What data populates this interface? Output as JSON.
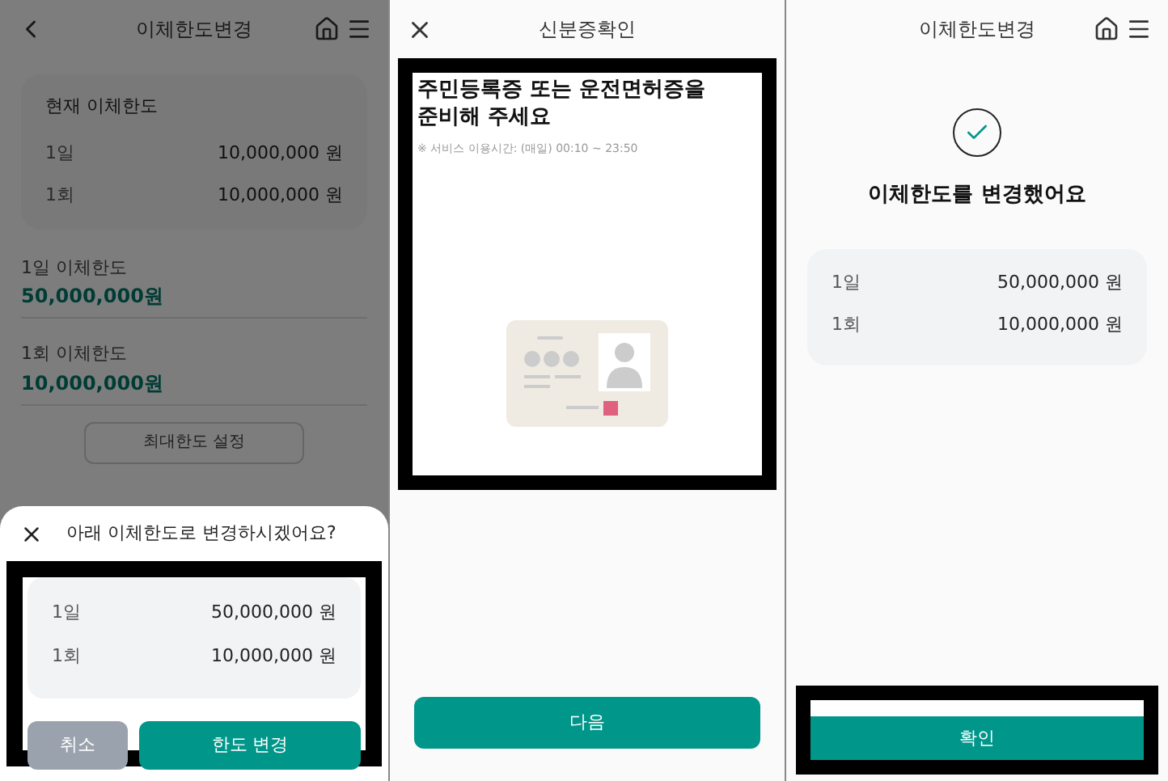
{
  "screen_1": {
    "header": {
      "title": "이체한도변경"
    },
    "current_limit": {
      "title": "현재 이체한도",
      "rows": [
        {
          "label": "1일",
          "value": "10,000,000 원"
        },
        {
          "label": "1회",
          "value": "10,000,000 원"
        }
      ]
    },
    "fields": [
      {
        "label": "1일 이체한도",
        "value": "50,000,000원"
      },
      {
        "label": "1회 이체한도",
        "value": "10,000,000원"
      }
    ],
    "max_button": "최대한도 설정",
    "sheet": {
      "title": "아래 이체한도로 변경하시겠어요?",
      "rows": [
        {
          "label": "1일",
          "value": "50,000,000 원"
        },
        {
          "label": "1회",
          "value": "10,000,000 원"
        }
      ],
      "cancel": "취소",
      "confirm": "한도 변경"
    }
  },
  "screen_2": {
    "header": {
      "title": "신분증확인"
    },
    "heading": "주민등록증 또는 운전면허증을\n준비해 주세요",
    "note": "※ 서비스 이용시간: (매일) 00:10 ~ 23:50",
    "next": "다음"
  },
  "screen_3": {
    "header": {
      "title": "이체한도변경"
    },
    "message": "이체한도를 변경했어요",
    "rows": [
      {
        "label": "1일",
        "value": "50,000,000 원"
      },
      {
        "label": "1회",
        "value": "10,000,000 원"
      }
    ],
    "confirm": "확인"
  }
}
